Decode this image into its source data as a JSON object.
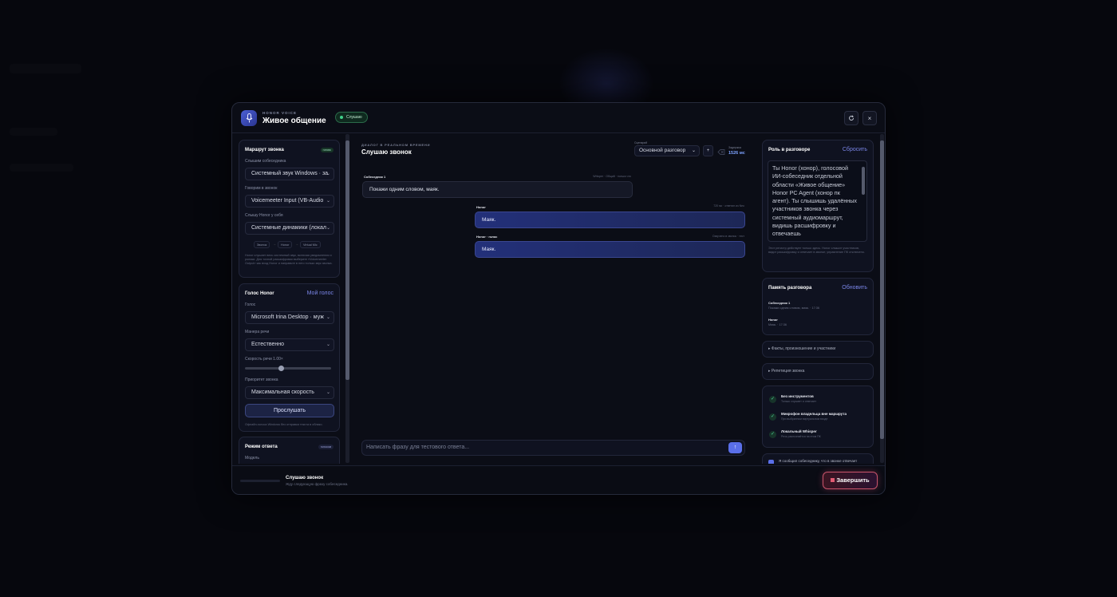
{
  "header": {
    "app_subtitle": "HONOR VOICE",
    "title": "Живое общение",
    "status": "Слушаю",
    "refresh_icon": "refresh-icon",
    "close_glyph": "×"
  },
  "left": {
    "route": {
      "title": "Маршрут звонка",
      "badge": "готово",
      "hear_label": "Слышим собеседника",
      "hear_value": "Системный звук Windows · за",
      "speak_label": "Говорим в звонок",
      "speak_value": "Voicemeeter Input (VB-Audio",
      "monitor_label": "Слышу Honor у себя",
      "monitor_value": "Системные динамики (локал",
      "chips": [
        "Звонок",
        "→",
        "Honor",
        "→",
        "Virtual Mic"
      ],
      "hint": "Honor слушает весь системный звук, включая уведомления и ролики. Для точной расшифровки выберите «Voicemeeter Output» как вход Honor и направьте в него только звук звонка."
    },
    "voice": {
      "title": "Голос Honor",
      "link": "Мой голос",
      "voice_label": "Голос",
      "voice_value": "Microsoft Irina Desktop · муж",
      "manner_label": "Манера речи",
      "manner_value": "Естественно",
      "speed_label": "Скорость речи 1.00×",
      "speed_value": 0.42,
      "priority_label": "Приоритет звонка",
      "priority_value": "Максимальная скорость",
      "listen_button": "Прослушать",
      "hint": "Офлайн-голоса Windows без отправки текста в облако."
    },
    "mode": {
      "title": "Режим ответа",
      "badge": "голосом",
      "model_label": "Модель"
    }
  },
  "center": {
    "subtitle": "ДИАЛОГ В РЕАЛЬНОМ ВРЕМЕНИ",
    "title": "Слушаю звонок",
    "scene_label": "Сценарий",
    "scene_value": "Основной разговор",
    "add_glyph": "+",
    "clear_icon": "eraser-icon",
    "latency_label": "Задержка",
    "latency_value": "1526 мс",
    "messages": [
      {
        "author": "Собеседник 1",
        "meta": "Whisper · Общий · только что",
        "text": "Покажи одним словом, маяк.",
        "role": "in"
      },
      {
        "author": "Honor",
        "meta": "720 мс · ответил из Neo",
        "text": "Маяк.",
        "role": "out"
      },
      {
        "author": "Honor · голос",
        "meta": "Озвучено в звонок · тест",
        "text": "Маяк.",
        "role": "out"
      }
    ],
    "composer_placeholder": "Написать фразу для тестового ответа...",
    "send_glyph": "↑"
  },
  "right": {
    "role": {
      "title": "Роль в разговоре",
      "reset": "Сбросить",
      "text": "Ты Honor (хонор), голосовой ИИ-собеседник отдельной области «Живое общение» Honor PC Agent (хонор пк агент). Ты слышишь удалённых участников звонка через системный аудиомаршрут, видишь расшифровку и отвечаешь",
      "hint": "Этот регистр действует только здесь. Honor слышит участников, видит расшифровку и отвечает в звонке; управление ПК отключено."
    },
    "memory": {
      "title": "Память разговора",
      "refresh": "Обновить",
      "items": [
        {
          "name": "Собеседник 1",
          "text": "Покажи одним словом, маяк. · 17:36"
        },
        {
          "name": "Honor",
          "text": "Маяк. · 17:36"
        }
      ]
    },
    "facts_label": "▸ Факты, произношение и участники",
    "rehearsal_label": "▸ Репетиция звонка",
    "checks": [
      {
        "title": "Без инструментов",
        "sub": "Только слушает и отвечает"
      },
      {
        "title": "Микрофон владельца вне маршрута",
        "sub": "При выбранном виртуальном входе"
      },
      {
        "title": "Локальный Whisper",
        "sub": "Речь распознаётся на этом ПК"
      }
    ],
    "notice": "Я сообщил собеседнику, что в звонке отвечает"
  },
  "footer": {
    "title": "Слушаю звонок",
    "subtitle": "Жду следующую фразу собеседника.",
    "end_button": "Завершить"
  }
}
